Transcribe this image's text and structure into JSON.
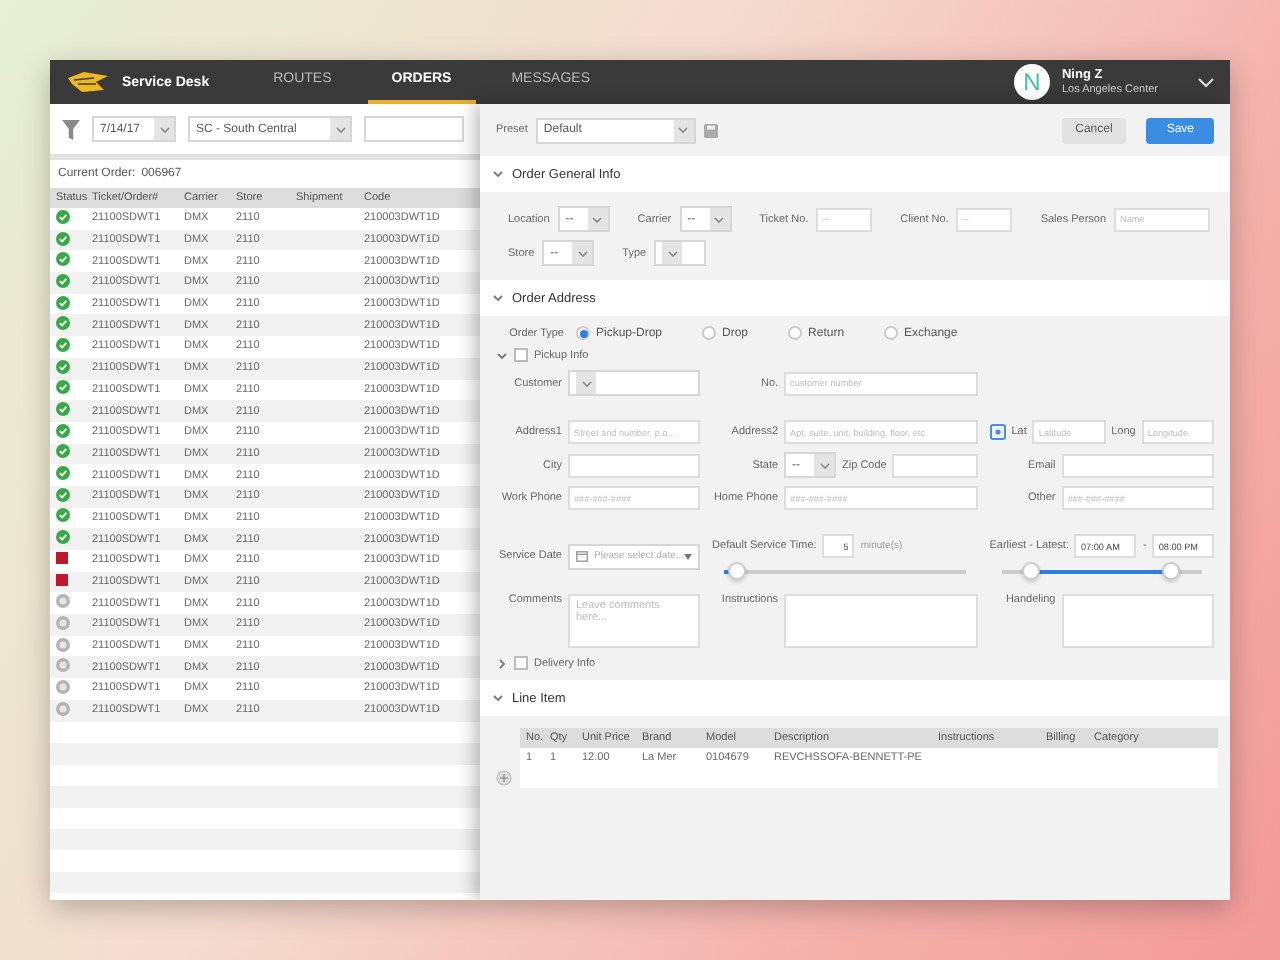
{
  "header": {
    "app_name": "Service Desk",
    "tabs": [
      {
        "label": "ROUTES",
        "selected": false
      },
      {
        "label": "ORDERS",
        "selected": true
      },
      {
        "label": "MESSAGES",
        "selected": false
      }
    ],
    "user": {
      "initial": "N",
      "name": "Ning Z",
      "location": "Los Angeles Center"
    }
  },
  "orders": {
    "date": "7/14/17",
    "region": "SC - South Central",
    "current_order_label": "Current Order:",
    "current_order": "006967",
    "columns": [
      "Status",
      "Ticket/Order#",
      "Carrier",
      "Store",
      "Shipment",
      "Code"
    ],
    "rows": [
      {
        "kind": "done",
        "ticket": "21100SDWT1",
        "carrier": "DMX",
        "store": "2110",
        "code": "210003DWT1D"
      },
      {
        "kind": "done",
        "ticket": "21100SDWT1",
        "carrier": "DMX",
        "store": "2110",
        "code": "210003DWT1D"
      },
      {
        "kind": "done",
        "ticket": "21100SDWT1",
        "carrier": "DMX",
        "store": "2110",
        "code": "210003DWT1D"
      },
      {
        "kind": "done",
        "ticket": "21100SDWT1",
        "carrier": "DMX",
        "store": "2110",
        "code": "210003DWT1D"
      },
      {
        "kind": "done",
        "ticket": "21100SDWT1",
        "carrier": "DMX",
        "store": "2110",
        "code": "210003DWT1D"
      },
      {
        "kind": "done",
        "ticket": "21100SDWT1",
        "carrier": "DMX",
        "store": "2110",
        "code": "210003DWT1D"
      },
      {
        "kind": "done",
        "ticket": "21100SDWT1",
        "carrier": "DMX",
        "store": "2110",
        "code": "210003DWT1D"
      },
      {
        "kind": "done",
        "ticket": "21100SDWT1",
        "carrier": "DMX",
        "store": "2110",
        "code": "210003DWT1D"
      },
      {
        "kind": "done",
        "ticket": "21100SDWT1",
        "carrier": "DMX",
        "store": "2110",
        "code": "210003DWT1D"
      },
      {
        "kind": "done",
        "ticket": "21100SDWT1",
        "carrier": "DMX",
        "store": "2110",
        "code": "210003DWT1D"
      },
      {
        "kind": "done",
        "ticket": "21100SDWT1",
        "carrier": "DMX",
        "store": "2110",
        "code": "210003DWT1D"
      },
      {
        "kind": "done",
        "ticket": "21100SDWT1",
        "carrier": "DMX",
        "store": "2110",
        "code": "210003DWT1D"
      },
      {
        "kind": "done",
        "ticket": "21100SDWT1",
        "carrier": "DMX",
        "store": "2110",
        "code": "210003DWT1D"
      },
      {
        "kind": "done",
        "ticket": "21100SDWT1",
        "carrier": "DMX",
        "store": "2110",
        "code": "210003DWT1D"
      },
      {
        "kind": "done",
        "ticket": "21100SDWT1",
        "carrier": "DMX",
        "store": "2110",
        "code": "210003DWT1D"
      },
      {
        "kind": "done",
        "ticket": "21100SDWT1",
        "carrier": "DMX",
        "store": "2110",
        "code": "210003DWT1D"
      },
      {
        "kind": "failed",
        "ticket": "21100SDWT1",
        "carrier": "DMX",
        "store": "2110",
        "code": "210003DWT1D"
      },
      {
        "kind": "failed",
        "ticket": "21100SDWT1",
        "carrier": "DMX",
        "store": "2110",
        "code": "210003DWT1D"
      },
      {
        "kind": "pending",
        "ticket": "21100SDWT1",
        "carrier": "DMX",
        "store": "2110",
        "code": "210003DWT1D"
      },
      {
        "kind": "pending",
        "ticket": "21100SDWT1",
        "carrier": "DMX",
        "store": "2110",
        "code": "210003DWT1D"
      },
      {
        "kind": "pending",
        "ticket": "21100SDWT1",
        "carrier": "DMX",
        "store": "2110",
        "code": "210003DWT1D"
      },
      {
        "kind": "pending",
        "ticket": "21100SDWT1",
        "carrier": "DMX",
        "store": "2110",
        "code": "210003DWT1D"
      },
      {
        "kind": "pending",
        "ticket": "21100SDWT1",
        "carrier": "DMX",
        "store": "2110",
        "code": "210003DWT1D"
      },
      {
        "kind": "pending",
        "ticket": "21100SDWT1",
        "carrier": "DMX",
        "store": "2110",
        "code": "210003DWT1D"
      }
    ]
  },
  "form": {
    "preset_label": "Preset",
    "preset": "Default",
    "cancel": "Cancel",
    "save": "Save",
    "general": {
      "title": "Order General Info",
      "expanded": true,
      "rows": [
        [
          {
            "label": "Location",
            "kind": "select",
            "value": "--"
          },
          {
            "label": "Carrier",
            "kind": "select",
            "value": "--"
          },
          {
            "label": "Ticket No.",
            "kind": "input",
            "placeholder": "--"
          },
          {
            "label": "Client No.",
            "kind": "input",
            "placeholder": "--"
          },
          {
            "label": "Sales Person",
            "kind": "input",
            "placeholder": "Name"
          }
        ],
        [
          {
            "label": "Store",
            "kind": "select",
            "value": "--"
          },
          {
            "label": "Type",
            "kind": "select"
          }
        ]
      ]
    },
    "address": {
      "title": "Order Address",
      "expanded": true,
      "order_type": {
        "label": "Order Type",
        "options": [
          {
            "label": "Pickup-Drop",
            "selected": true
          },
          {
            "label": "Drop",
            "selected": false
          },
          {
            "label": "Return",
            "selected": false
          },
          {
            "label": "Exchange",
            "selected": false
          }
        ]
      },
      "pickup_info": {
        "label": "Pickup Info",
        "checked": false,
        "expanded": true
      },
      "rows": [
        [
          [
            {
              "label": "Customer",
              "kind": "select"
            }
          ],
          [
            {
              "label": "No.",
              "kind": "input",
              "placeholder": "customer number"
            }
          ]
        ],
        [
          [
            {
              "label": "Address1",
              "kind": "input",
              "placeholder": "Street and number, p.o..."
            }
          ],
          [
            {
              "label": "Address2",
              "kind": "input",
              "placeholder": "Apt, suite, unit, building, floor, etc."
            }
          ],
          [
            {
              "kind": "locate"
            },
            {
              "label": "Lat",
              "kind": "input",
              "placeholder": "Latitude"
            },
            {
              "label": "Long",
              "kind": "input",
              "placeholder": "Longitude"
            }
          ]
        ],
        [
          [
            {
              "label": "City",
              "kind": "input"
            }
          ],
          [
            {
              "label": "State",
              "kind": "select",
              "value": "--"
            },
            {
              "label": "Zip Code",
              "kind": "input"
            }
          ],
          [
            {
              "label": "Email",
              "kind": "input"
            }
          ]
        ],
        [
          [
            {
              "label": "Work Phone",
              "kind": "input",
              "placeholder": "###-###-####"
            }
          ],
          [
            {
              "label": "Home Phone",
              "kind": "input",
              "placeholder": "###-###-####"
            }
          ],
          [
            {
              "label": "Other",
              "kind": "input",
              "placeholder": "###-###-####"
            }
          ]
        ]
      ],
      "service_date": {
        "label": "Service Date",
        "placeholder": "Please select date..."
      },
      "service_time": {
        "label": "Default Service Time:",
        "value": "5",
        "unit": "minute(s)",
        "level": 0.05
      },
      "time_window": {
        "label": "Earliest - Latest:",
        "start": "07:00 AM",
        "separator": "-",
        "end": "08:00 PM",
        "thumbs": [
          {
            "level": 0.15
          },
          {
            "level": 0.85
          }
        ]
      },
      "notes": [
        {
          "label": "Comments",
          "placeholder": "Leave comments here..."
        },
        {
          "label": "Instructions"
        },
        {
          "label": "Handeling"
        }
      ],
      "delivery_info": {
        "label": "Delivery Info",
        "checked": false,
        "expanded": false
      }
    },
    "line_items": {
      "title": "Line Item",
      "expanded": true,
      "columns": [
        "No.",
        "Qty",
        "Unit Price",
        "Brand",
        "Model",
        "Description",
        "Instructions",
        "Billing",
        "Category"
      ],
      "rows": [
        [
          "1",
          "1",
          "12.00",
          "La Mer",
          "0104679",
          "REVCHSSOFA-BENNETT-PE",
          "",
          "",
          ""
        ]
      ]
    }
  }
}
